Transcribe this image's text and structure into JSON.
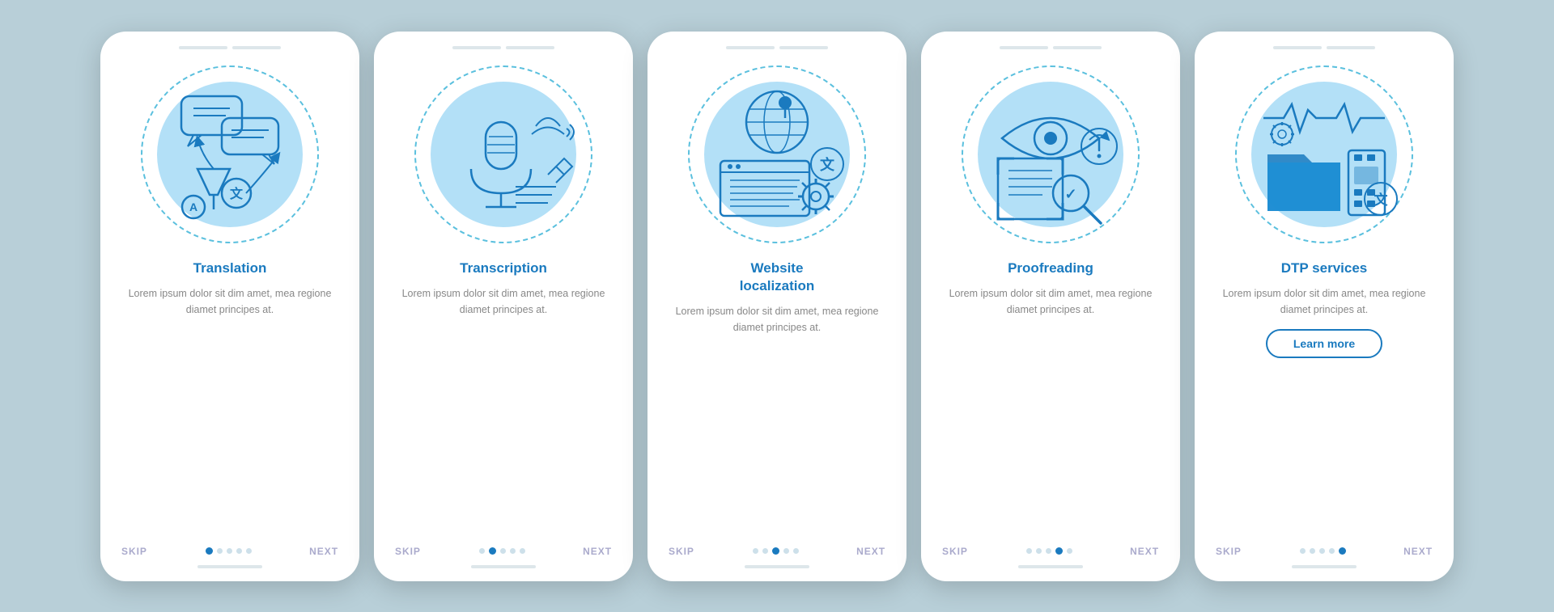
{
  "cards": [
    {
      "id": "translation",
      "title": "Translation",
      "description": "Lorem ipsum dolor sit dim amet, mea regione diamet principes at.",
      "active_dot": 0,
      "show_learn_more": false,
      "top_bar_count": 2,
      "dots": [
        true,
        false,
        false,
        false,
        false
      ]
    },
    {
      "id": "transcription",
      "title": "Transcription",
      "description": "Lorem ipsum dolor sit dim amet, mea regione diamet principes at.",
      "active_dot": 1,
      "show_learn_more": false,
      "top_bar_count": 2,
      "dots": [
        false,
        true,
        false,
        false,
        false
      ]
    },
    {
      "id": "website-localization",
      "title": "Website\nlocalization",
      "description": "Lorem ipsum dolor sit dim amet, mea regione diamet principes at.",
      "active_dot": 2,
      "show_learn_more": false,
      "top_bar_count": 2,
      "dots": [
        false,
        false,
        true,
        false,
        false
      ]
    },
    {
      "id": "proofreading",
      "title": "Proofreading",
      "description": "Lorem ipsum dolor sit dim amet, mea regione diamet principes at.",
      "active_dot": 3,
      "show_learn_more": false,
      "top_bar_count": 2,
      "dots": [
        false,
        false,
        false,
        true,
        false
      ]
    },
    {
      "id": "dtp-services",
      "title": "DTP services",
      "description": "Lorem ipsum dolor sit dim amet, mea regione diamet principes at.",
      "active_dot": 4,
      "show_learn_more": true,
      "learn_more_label": "Learn more",
      "top_bar_count": 2,
      "dots": [
        false,
        false,
        false,
        false,
        true
      ]
    }
  ],
  "skip_label": "SKIP",
  "next_label": "NEXT"
}
